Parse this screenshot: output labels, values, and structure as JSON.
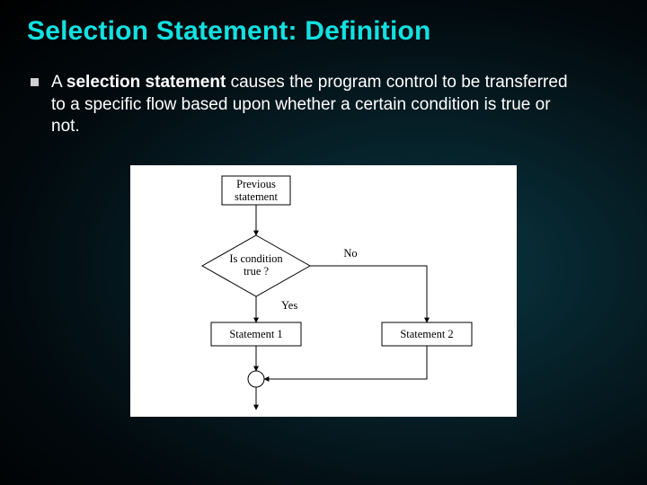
{
  "slide": {
    "title": "Selection Statement: Definition",
    "bullet": {
      "prefix": "A ",
      "bold": "selection statement",
      "rest": " causes the program control to be transferred to a specific flow based upon whether a certain condition is true or not."
    }
  },
  "flowchart": {
    "previous": "Previous\nstatement",
    "condition": "Is condition\ntrue ?",
    "yes": "Yes",
    "no": "No",
    "stmt1": "Statement 1",
    "stmt2": "Statement 2"
  }
}
